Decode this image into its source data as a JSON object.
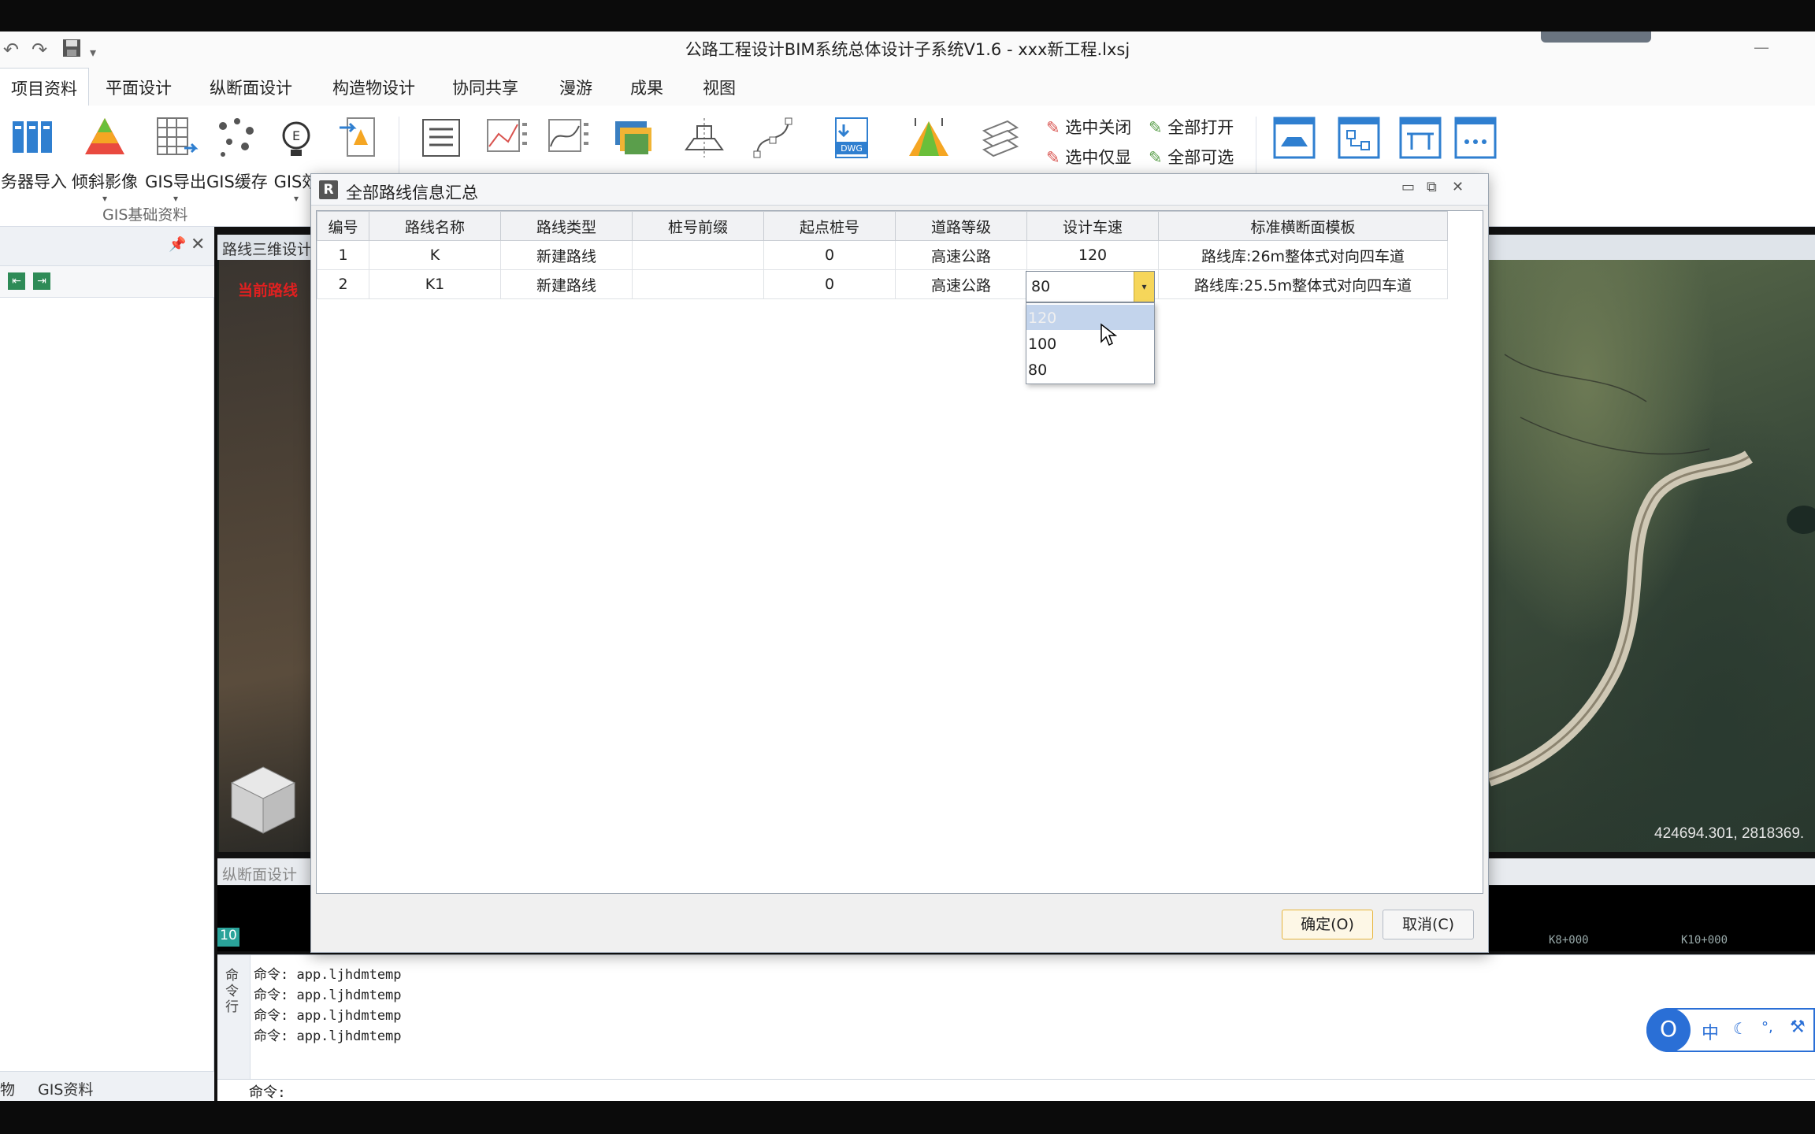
{
  "window": {
    "title": "公路工程设计BIM系统总体设计子系统V1.6 - xxx新工程.lxsj"
  },
  "menu_tabs": [
    "项目资料",
    "平面设计",
    "纵断面设计",
    "构造物设计",
    "协同共享",
    "漫游",
    "成果",
    "视图"
  ],
  "ribbon": {
    "large_buttons": [
      "务器导入",
      "倾斜影像",
      "GIS导出",
      "GIS缓存",
      "GIS效"
    ],
    "group_label": "GIS基础资料",
    "small_commands": [
      "选中关闭",
      "全部打开",
      "选中仅显",
      "全部可选"
    ],
    "dwg_label": "DWG"
  },
  "left_panel": {
    "bottom_tabs": [
      "物",
      "GIS资料"
    ]
  },
  "map": {
    "tab_label": "路线三维设计",
    "current_route_label": "当前路线",
    "coordinate": "424694.301, 2818369."
  },
  "profile": {
    "tab_label": "纵断面设计",
    "left_value": "10",
    "ticks": [
      "K8+000",
      "K10+000"
    ]
  },
  "console": {
    "side_label": "命令行",
    "lines": [
      "命令: app.ljhdmtemp",
      "命令: app.ljhdmtemp",
      "命令: app.ljhdmtemp",
      "命令: app.ljhdmtemp"
    ],
    "prompt": "命令:"
  },
  "ime": {
    "mode": "中"
  },
  "dialog": {
    "title": "全部路线信息汇总",
    "columns": [
      "编号",
      "路线名称",
      "路线类型",
      "桩号前缀",
      "起点桩号",
      "道路等级",
      "设计车速",
      "标准横断面模板"
    ],
    "rows": [
      [
        "1",
        "K",
        "新建路线",
        "",
        "0",
        "高速公路",
        "120",
        "路线库:26m整体式对向四车道"
      ],
      [
        "2",
        "K1",
        "新建路线",
        "",
        "0",
        "高速公路",
        "",
        "路线库:25.5m整体式对向四车道"
      ]
    ],
    "combo_value": "80",
    "dropdown_options": [
      "120",
      "100",
      "80"
    ],
    "selected_option_index": 0,
    "ok_label": "确定(O)",
    "cancel_label": "取消(C)"
  }
}
